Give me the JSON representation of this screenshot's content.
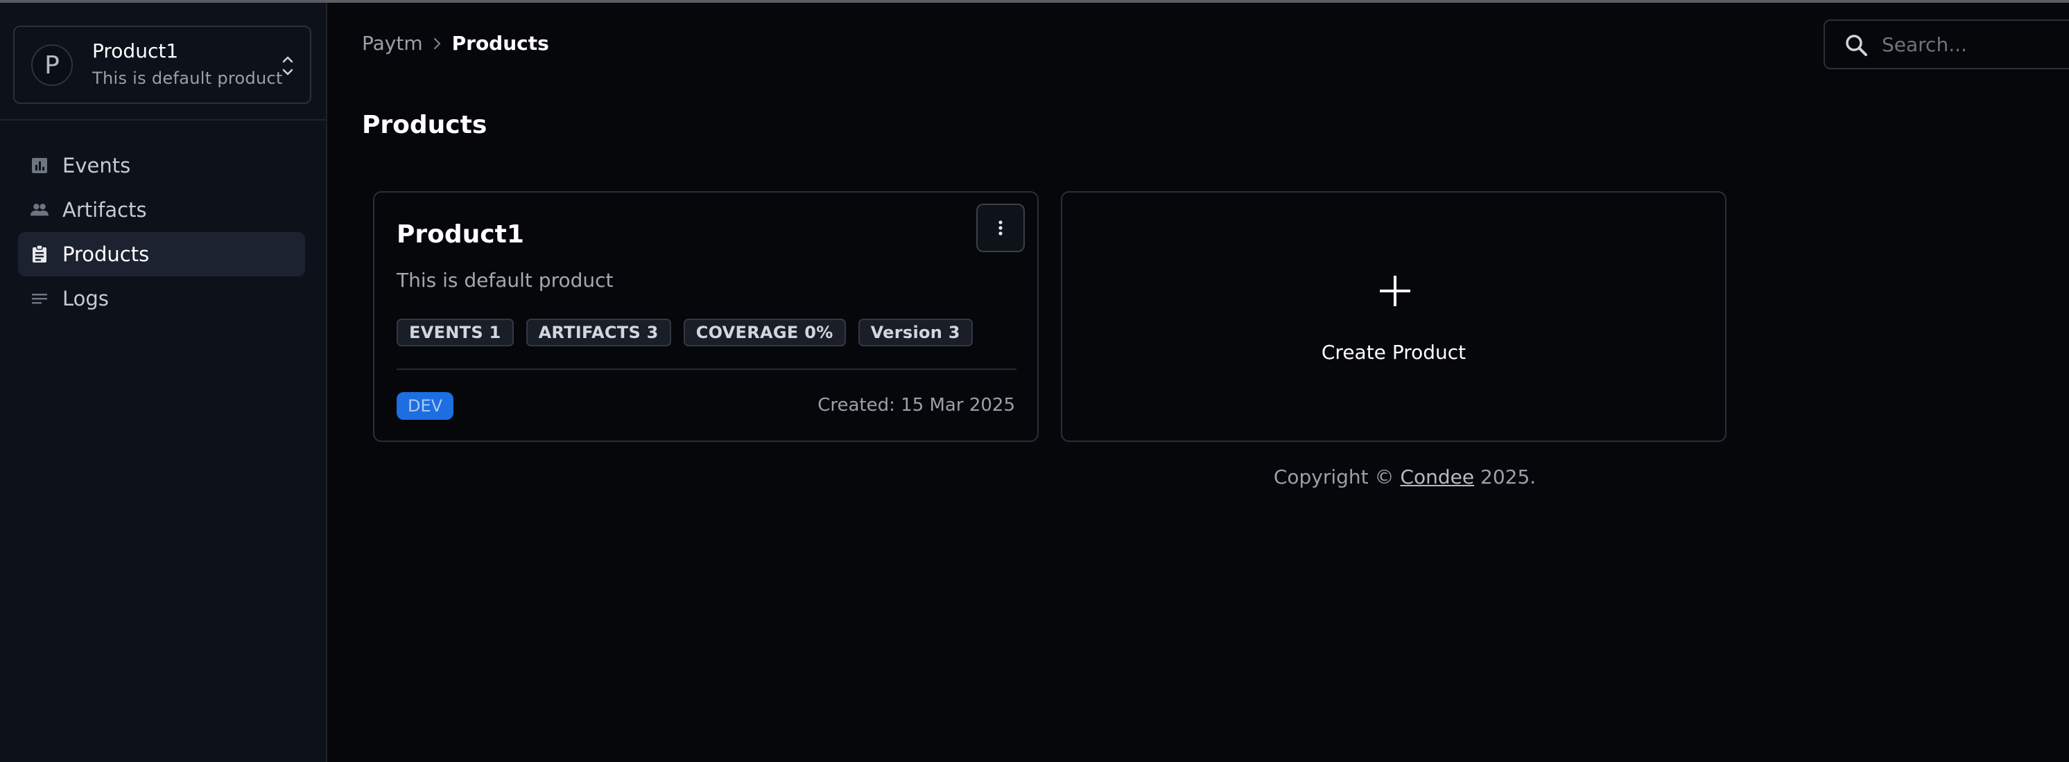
{
  "sidebar": {
    "switcher": {
      "avatar_letter": "P",
      "title": "Product1",
      "subtitle": "This is default product"
    },
    "items": [
      {
        "label": "Events",
        "icon": "bar-chart-icon"
      },
      {
        "label": "Artifacts",
        "icon": "people-icon"
      },
      {
        "label": "Products",
        "icon": "clipboard-icon",
        "active": true
      },
      {
        "label": "Logs",
        "icon": "lines-icon"
      }
    ]
  },
  "header": {
    "breadcrumb": [
      "Paytm",
      "Products"
    ],
    "search_placeholder": "Search..."
  },
  "main": {
    "title": "Products",
    "product_card": {
      "title": "Product1",
      "description": "This is default product",
      "tags": [
        "EVENTS 1",
        "ARTIFACTS 3",
        "COVERAGE 0%",
        "Version 3"
      ],
      "environment": "DEV",
      "created": "Created: 15 Mar 2025"
    },
    "create_card": {
      "label": "Create Product"
    }
  },
  "footer": {
    "prefix": "Copyright © ",
    "brand": "Condee",
    "suffix": " 2025."
  },
  "colors": {
    "background": "#06070b",
    "sidebar": "#0c111a",
    "active_nav": "#1c2230",
    "accent_blue": "#1d6ee0"
  }
}
